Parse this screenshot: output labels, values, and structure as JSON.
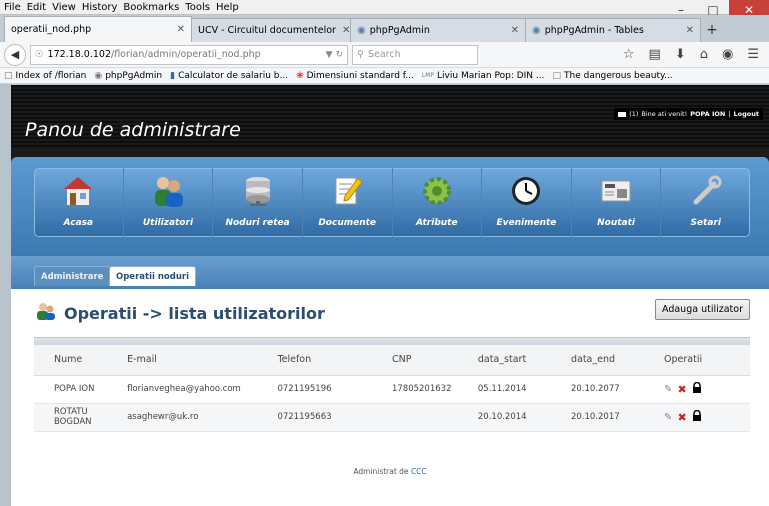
{
  "browser": {
    "menu": [
      "File",
      "Edit",
      "View",
      "History",
      "Bookmarks",
      "Tools",
      "Help"
    ],
    "tabs": [
      {
        "label": "operatii_nod.php",
        "active": true
      },
      {
        "label": "UCV - Circuitul documentelor",
        "active": false
      },
      {
        "label": "phpPgAdmin",
        "active": false
      },
      {
        "label": "phpPgAdmin - Tables",
        "active": false
      }
    ],
    "url_host": "172.18.0.102",
    "url_path": "/florian/admin/operatii_nod.php",
    "search_placeholder": "Search",
    "bookmarks": [
      "Index of /florian",
      "phpPgAdmin",
      "Calculator de salariu b...",
      "Dimensiuni standard f...",
      "Liviu Marian Pop: DIN ...",
      "The dangerous beauty..."
    ]
  },
  "header": {
    "title": "Panou de administrare",
    "welcome_count": "(1)",
    "welcome_text": "Bine ati venit!",
    "user": "POPA ION",
    "logout": "Logout"
  },
  "nav": [
    {
      "label": "Acasa",
      "icon": "home-icon"
    },
    {
      "label": "Utilizatori",
      "icon": "users-icon"
    },
    {
      "label": "Noduri retea",
      "icon": "server-icon"
    },
    {
      "label": "Documente",
      "icon": "document-icon"
    },
    {
      "label": "Atribute",
      "icon": "gear-icon"
    },
    {
      "label": "Evenimente",
      "icon": "clock-icon"
    },
    {
      "label": "Noutati",
      "icon": "news-icon"
    },
    {
      "label": "Setari",
      "icon": "wrench-icon"
    }
  ],
  "subtabs": {
    "admin": "Administrare",
    "ops": "Operatii noduri"
  },
  "content": {
    "title": "Operatii -> lista utilizatorilor",
    "add_button": "Adauga utilizator",
    "columns": [
      "Nume",
      "E-mail",
      "Telefon",
      "CNP",
      "data_start",
      "data_end",
      "Operatii"
    ],
    "rows": [
      {
        "nume": "POPA ION",
        "email": "florianveghea@yahoo.com",
        "telefon": "0721195196",
        "cnp": "17805201632",
        "start": "05.11.2014",
        "end": "20.10.2077"
      },
      {
        "nume": "ROTATU BOGDAN",
        "email": "asaghewr@uk.ro",
        "telefon": "0721195663",
        "cnp": "",
        "start": "20.10.2014",
        "end": "20.10.2017"
      }
    ]
  },
  "footer": {
    "prefix": "Administrat de",
    "link": "CCC"
  }
}
